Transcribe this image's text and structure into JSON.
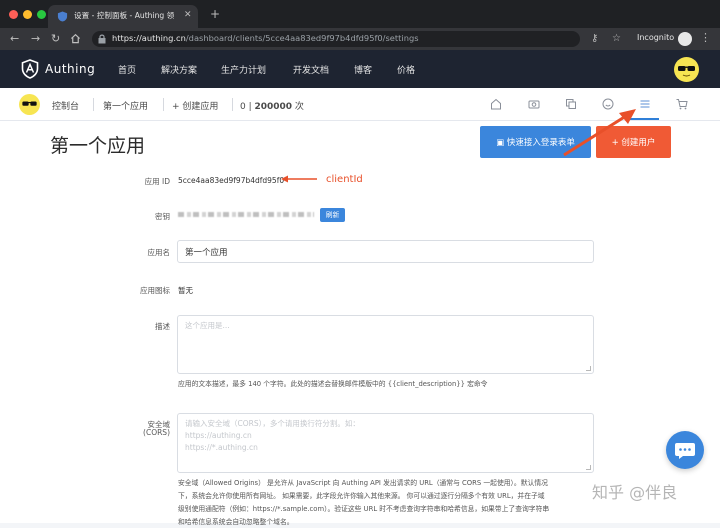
{
  "browser": {
    "tab_title": "设置 - 控制面板 - Authing 领先…",
    "url_host": "https://authing.cn",
    "url_path": "/dashboard/clients/5cce4aa83ed9f97b4dfd95f0/settings",
    "incognito_label": "Incognito"
  },
  "header": {
    "logo_text": "Authing",
    "nav": [
      "首页",
      "解决方案",
      "生产力计划",
      "开发文档",
      "博客",
      "价格"
    ]
  },
  "subheader": {
    "console": "控制台",
    "app_name": "第一个应用",
    "create_app": "+ 创建应用",
    "usage_prefix": "0 | ",
    "usage_total": "200000",
    "usage_unit": " 次"
  },
  "page": {
    "title": "第一个应用",
    "quick_connect_button": "快速接入登录表单",
    "create_user_button": "+ 创建用户"
  },
  "fields": {
    "app_id_label": "应用 ID",
    "app_id_value": "5cce4aa83ed9f97b4dfd95f0",
    "annotation": "clientId",
    "secret_label": "密钥",
    "refresh_label": "刷新",
    "app_name_label": "应用名",
    "app_name_value": "第一个应用",
    "app_icon_label": "应用图标",
    "app_icon_value": "暂无",
    "description_label": "描述",
    "description_placeholder": "这个应用是...",
    "description_help": "应用的文本描述，最多 140 个字符。此处的描述会替换邮件模版中的 {{client_description}} 宏命令",
    "cors_label_1": "安全域",
    "cors_label_2": "(CORS)",
    "cors_placeholder_1": "请输入安全域（CORS），多个请用换行符分割。如：",
    "cors_placeholder_2": "https://authing.cn",
    "cors_placeholder_3": "https://*.authing.cn",
    "cors_help_1": "安全域（Allowed Origins） 是允许从 JavaScript 向 Authing API 发出请求的 URL（通常与 CORS 一起使用）。默认情况",
    "cors_help_2": "下，系统会允许你使用所有网址。 如果需要，此字段允许你输入其他来源。 你可以通过逐行分隔多个有效 URL，并在子域",
    "cors_help_3": "级别使用通配符（例如：https://*.sample.com）。验证这些 URL 时不考虑查询字符串和哈希信息，如果带上了查询字符串",
    "cors_help_4": "和哈希信息系统会自动忽略整个域名。"
  },
  "watermark": "知乎 @伴良",
  "colors": {
    "primary": "#3b86dc",
    "accent": "#f05a35",
    "header_bg": "#1e2431"
  }
}
